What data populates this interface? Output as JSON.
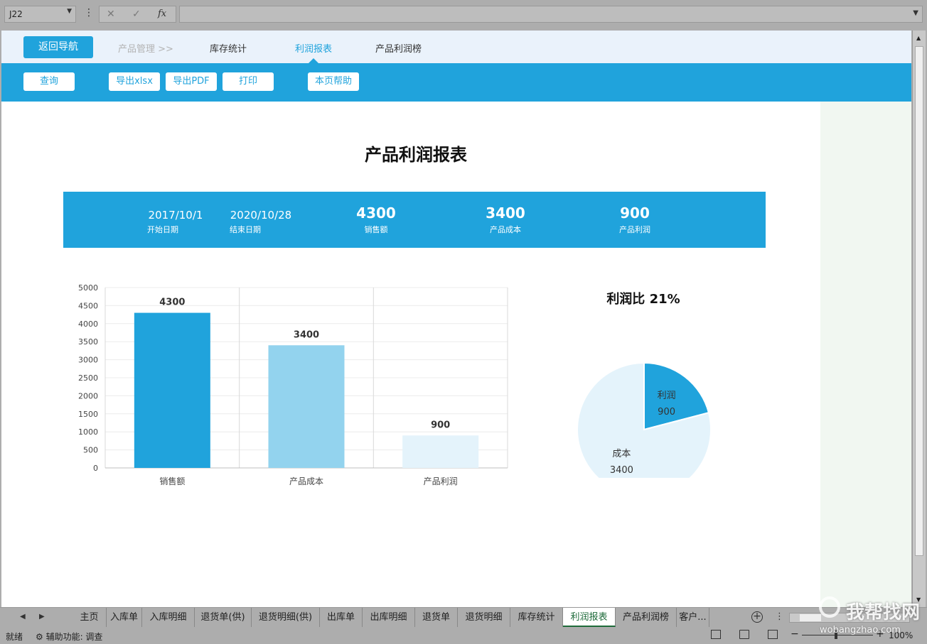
{
  "formula_bar": {
    "name_box": "J22",
    "formula": "",
    "cancel_icon": "✕",
    "enter_icon": "✓",
    "fx_label": "fx"
  },
  "nav": {
    "back_button": "返回导航",
    "items": [
      "产品管理 >>",
      "库存统计",
      "利润报表",
      "产品利润榜"
    ],
    "active": "利润报表"
  },
  "toolbar": {
    "query": "查询",
    "export_xlsx": "导出xlsx",
    "export_pdf": "导出PDF",
    "print": "打印",
    "help": "本页帮助"
  },
  "report": {
    "title": "产品利润报表",
    "start_date": "2017/10/1",
    "start_label": "开始日期",
    "end_date": "2020/10/28",
    "end_label": "结束日期",
    "sales": "4300",
    "sales_label": "销售额",
    "cost": "3400",
    "cost_label": "产品成本",
    "profit": "900",
    "profit_label": "产品利润"
  },
  "chart_data": [
    {
      "type": "bar",
      "categories": [
        "销售额",
        "产品成本",
        "产品利润"
      ],
      "values": [
        4300,
        3400,
        900
      ],
      "colors": [
        "#20a3dc",
        "#93d3ee",
        "#e4f3fb"
      ],
      "ylim": [
        0,
        5000
      ],
      "yticks": [
        0,
        500,
        1000,
        1500,
        2000,
        2500,
        3000,
        3500,
        4000,
        4500,
        5000
      ],
      "grid": true,
      "title": "",
      "xlabel": "",
      "ylabel": ""
    },
    {
      "type": "pie",
      "title": "利润比 21%",
      "slices": [
        {
          "label": "利润",
          "value": 900,
          "color": "#20a3dc"
        },
        {
          "label": "成本",
          "value": 3400,
          "color": "#e4f3fb"
        }
      ]
    }
  ],
  "sheet_tabs": [
    "主页",
    "入库单",
    "入库明细",
    "退货单(供)",
    "退货明细(供)",
    "出库单",
    "出库明细",
    "退货单",
    "退货明细",
    "库存统计",
    "利润报表",
    "产品利润榜",
    "客户..."
  ],
  "active_tab": "利润报表",
  "status": {
    "ready": "就绪",
    "accessibility": "辅助功能: 调查",
    "zoom": "100%"
  },
  "watermark": {
    "text": "我帮找网",
    "url": "wobangzhao.com"
  }
}
